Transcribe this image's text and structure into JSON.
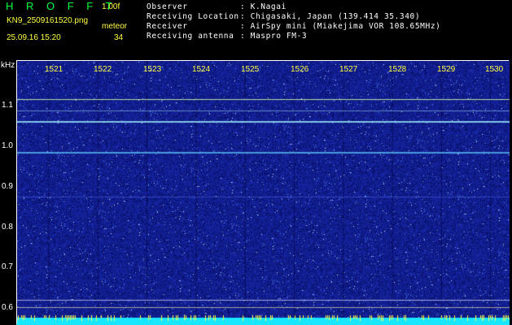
{
  "header": {
    "brand": "H R O F F T",
    "version": "1.00f",
    "filename": "KN9_2509161520.png",
    "datetime": "25.09.16 15:20",
    "mode": "meteor",
    "count": "34"
  },
  "info": {
    "observer_label": "Observer",
    "observer_value": ": K.Nagai",
    "location_label": "Receiving Location",
    "location_value": ": Chigasaki, Japan (139.414 35.340)",
    "receiver_label": "Receiver",
    "receiver_value": ": AirSpy mini (Miakejima VOR 108.65MHz)",
    "antenna_label": "Receiving antenna",
    "antenna_value": ": Maspro FM-3"
  },
  "axis": {
    "y_unit": "kHz",
    "y_ticks": [
      "1.1",
      "1.0",
      "0.9",
      "0.8",
      "0.7",
      "0.6"
    ],
    "x_ticks": [
      "1521",
      "1522",
      "1523",
      "1524",
      "1525",
      "1526",
      "1527",
      "1528",
      "1529",
      "1530"
    ]
  },
  "colors": {
    "background": "#000000",
    "waterfall": "#0f1c8c",
    "brand": "#00ff40",
    "yellow": "#ffff40",
    "cyan_bar": "#19e6ff"
  }
}
